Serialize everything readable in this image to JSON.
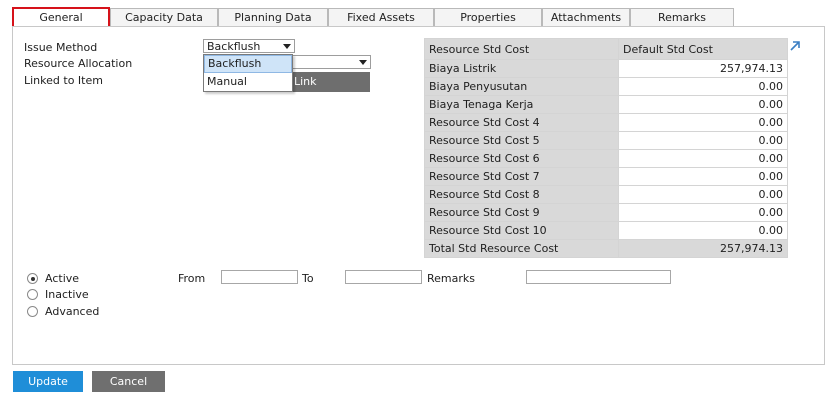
{
  "tabs": [
    {
      "label": "General",
      "active": true
    },
    {
      "label": "Capacity Data",
      "active": false
    },
    {
      "label": "Planning Data",
      "active": false
    },
    {
      "label": "Fixed Assets",
      "active": false
    },
    {
      "label": "Properties",
      "active": false
    },
    {
      "label": "Attachments",
      "active": false
    },
    {
      "label": "Remarks",
      "active": false
    }
  ],
  "form": {
    "issue_method_label": "Issue Method",
    "issue_method_value": "Backflush",
    "resource_allocation_label": "Resource Allocation",
    "linked_to_item_label": "Linked to Item",
    "dropdown_options": [
      "Backflush",
      "Manual"
    ],
    "link_text": "Link"
  },
  "cost_table": {
    "header_name": "Resource Std Cost",
    "header_value": "Default Std Cost",
    "rows": [
      {
        "name": "Biaya Listrik",
        "value": "257,974.13"
      },
      {
        "name": "Biaya Penyusutan",
        "value": "0.00"
      },
      {
        "name": "Biaya Tenaga Kerja",
        "value": "0.00"
      },
      {
        "name": "Resource Std Cost 4",
        "value": "0.00"
      },
      {
        "name": "Resource Std Cost 5",
        "value": "0.00"
      },
      {
        "name": "Resource Std Cost 6",
        "value": "0.00"
      },
      {
        "name": "Resource Std Cost 7",
        "value": "0.00"
      },
      {
        "name": "Resource Std Cost 8",
        "value": "0.00"
      },
      {
        "name": "Resource Std Cost 9",
        "value": "0.00"
      },
      {
        "name": "Resource Std Cost 10",
        "value": "0.00"
      }
    ],
    "total_name": "Total Std Resource Cost",
    "total_value": "257,974.13"
  },
  "status": {
    "active_label": "Active",
    "inactive_label": "Inactive",
    "advanced_label": "Advanced",
    "selected": "Active",
    "from_label": "From",
    "to_label": "To",
    "remarks_label": "Remarks",
    "from_value": "",
    "to_value": "",
    "remarks_value": ""
  },
  "buttons": {
    "update_label": "Update",
    "cancel_label": "Cancel"
  },
  "colors": {
    "active_tab_border": "#d6121a",
    "update_button": "#1f8ed8",
    "cancel_button": "#6f6f6f"
  }
}
